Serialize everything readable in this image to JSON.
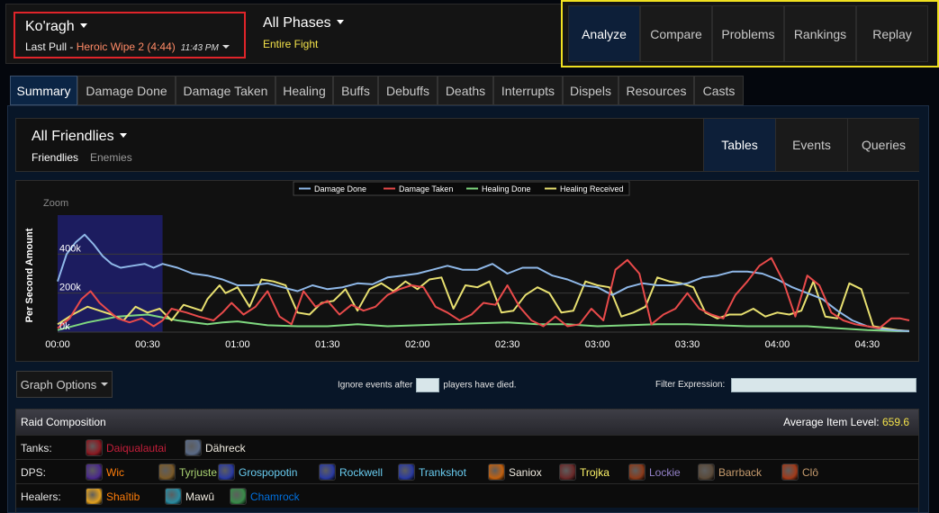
{
  "fight": {
    "boss": "Ko'ragh",
    "pull_prefix": "Last Pull - ",
    "pull_name": "Heroic Wipe 2 (4:44)",
    "pull_time": "11:43 PM"
  },
  "phase": {
    "name": "All Phases",
    "sub": "Entire Fight"
  },
  "nav": [
    "Analyze",
    "Compare",
    "Problems",
    "Rankings",
    "Replay"
  ],
  "tabs": [
    "Summary",
    "Damage Done",
    "Damage Taken",
    "Healing",
    "Buffs",
    "Debuffs",
    "Deaths",
    "Interrupts",
    "Dispels",
    "Resources",
    "Casts"
  ],
  "friendly": {
    "title": "All Friendlies",
    "friendlies": "Friendlies",
    "enemies": "Enemies"
  },
  "views": [
    "Tables",
    "Events",
    "Queries"
  ],
  "chart_data": {
    "type": "line",
    "ylabel": "Per Second Amount",
    "zoom_label": "Zoom",
    "ytick_labels": [
      "0k",
      "200k",
      "400k"
    ],
    "yticks": [
      0,
      200,
      400
    ],
    "ylim": [
      0,
      600
    ],
    "xlim": [
      0,
      284
    ],
    "xticks": [
      0,
      30,
      60,
      90,
      120,
      150,
      180,
      210,
      240,
      270
    ],
    "xtick_labels": [
      "00:00",
      "00:30",
      "01:00",
      "01:30",
      "02:00",
      "02:30",
      "03:00",
      "03:30",
      "04:00",
      "04:30"
    ],
    "zoom_range": [
      0,
      35
    ],
    "legend_position": "top-center",
    "series": [
      {
        "name": "Damage Done",
        "color": "#8fb8e8",
        "x": [
          0,
          3,
          6,
          9,
          12,
          15,
          18,
          21,
          25,
          29,
          32,
          35,
          40,
          45,
          50,
          55,
          60,
          65,
          70,
          75,
          80,
          85,
          90,
          95,
          100,
          105,
          110,
          115,
          120,
          125,
          130,
          135,
          140,
          145,
          150,
          155,
          160,
          165,
          170,
          175,
          180,
          185,
          190,
          195,
          200,
          205,
          210,
          215,
          220,
          225,
          230,
          235,
          240,
          245,
          250,
          255,
          260,
          265,
          270,
          275,
          280,
          284
        ],
        "y": [
          260,
          400,
          460,
          500,
          450,
          390,
          350,
          330,
          340,
          350,
          330,
          350,
          330,
          300,
          290,
          270,
          240,
          240,
          250,
          230,
          210,
          240,
          220,
          230,
          250,
          245,
          280,
          290,
          300,
          320,
          340,
          320,
          320,
          350,
          300,
          330,
          330,
          290,
          270,
          240,
          230,
          190,
          230,
          250,
          240,
          240,
          250,
          280,
          290,
          310,
          310,
          300,
          270,
          230,
          200,
          170,
          110,
          60,
          30,
          15,
          8,
          5
        ]
      },
      {
        "name": "Damage Taken",
        "color": "#e84a4a",
        "x": [
          0,
          4,
          8,
          11,
          14,
          17,
          20,
          24,
          28,
          32,
          35,
          38,
          43,
          47,
          52,
          55,
          58,
          62,
          66,
          70,
          74,
          78,
          82,
          86,
          90,
          94,
          98,
          102,
          106,
          110,
          114,
          118,
          122,
          126,
          130,
          134,
          138,
          142,
          146,
          150,
          154,
          158,
          162,
          166,
          170,
          174,
          178,
          182,
          186,
          190,
          194,
          198,
          202,
          206,
          210,
          214,
          218,
          222,
          226,
          230,
          234,
          238,
          242,
          246,
          250,
          254,
          258,
          262,
          266,
          270,
          274,
          278,
          281,
          284
        ],
        "y": [
          20,
          70,
          170,
          210,
          150,
          110,
          70,
          50,
          70,
          30,
          60,
          120,
          100,
          80,
          60,
          100,
          150,
          90,
          130,
          210,
          80,
          40,
          210,
          130,
          160,
          90,
          140,
          110,
          130,
          190,
          220,
          240,
          230,
          130,
          100,
          60,
          90,
          150,
          140,
          240,
          130,
          60,
          30,
          80,
          30,
          40,
          120,
          60,
          320,
          370,
          300,
          40,
          90,
          120,
          200,
          120,
          90,
          70,
          190,
          260,
          340,
          380,
          260,
          80,
          290,
          240,
          100,
          60,
          40,
          30,
          20,
          70,
          70,
          60
        ]
      },
      {
        "name": "Healing Done",
        "color": "#7fd87f",
        "x": [
          0,
          10,
          20,
          30,
          40,
          50,
          55,
          60,
          70,
          80,
          90,
          100,
          110,
          120,
          130,
          140,
          150,
          160,
          170,
          180,
          190,
          200,
          210,
          220,
          230,
          240,
          250,
          260,
          270,
          280,
          284
        ],
        "y": [
          10,
          50,
          80,
          90,
          60,
          40,
          50,
          55,
          35,
          30,
          30,
          40,
          30,
          35,
          40,
          45,
          50,
          40,
          40,
          30,
          35,
          40,
          40,
          35,
          30,
          30,
          30,
          20,
          10,
          5,
          5
        ]
      },
      {
        "name": "Healing Received",
        "color": "#e8e070",
        "x": [
          0,
          5,
          10,
          14,
          18,
          22,
          26,
          30,
          34,
          38,
          42,
          48,
          50,
          54,
          56,
          60,
          64,
          68,
          72,
          76,
          80,
          84,
          88,
          92,
          96,
          100,
          104,
          108,
          112,
          116,
          120,
          124,
          128,
          132,
          136,
          140,
          144,
          148,
          152,
          156,
          160,
          164,
          168,
          172,
          176,
          180,
          184,
          188,
          192,
          196,
          200,
          204,
          208,
          212,
          216,
          220,
          224,
          228,
          232,
          236,
          240,
          244,
          248,
          252,
          256,
          260,
          264,
          268,
          272,
          276,
          280,
          284
        ],
        "y": [
          40,
          90,
          130,
          110,
          90,
          60,
          130,
          100,
          120,
          60,
          140,
          110,
          170,
          240,
          200,
          230,
          130,
          270,
          260,
          240,
          100,
          90,
          150,
          160,
          220,
          110,
          220,
          250,
          210,
          260,
          220,
          270,
          280,
          120,
          240,
          230,
          260,
          100,
          110,
          190,
          230,
          200,
          100,
          110,
          260,
          240,
          230,
          80,
          100,
          130,
          280,
          260,
          250,
          230,
          100,
          70,
          90,
          90,
          120,
          80,
          100,
          90,
          110,
          260,
          80,
          70,
          250,
          220,
          30,
          20,
          10,
          5
        ]
      }
    ]
  },
  "controls": {
    "graph_options": "Graph Options",
    "ignore_before": "Ignore events after",
    "ignore_after": "players have died.",
    "filter_label": "Filter Expression:"
  },
  "raid": {
    "title": "Raid Composition",
    "ilvl_label": "Average Item Level: ",
    "ilvl_value": "659.6",
    "rows": [
      {
        "label": "Tanks:",
        "players": [
          {
            "name": "Daiqualautai",
            "color": "#c41e3a",
            "icon": "death-knight-icon",
            "icon_color": "#8a1a22"
          },
          {
            "name": "Dähreck",
            "color": "#f0ebe0",
            "icon": "shield-icon",
            "icon_color": "#5a6a86"
          }
        ]
      },
      {
        "label": "DPS:",
        "players": [
          {
            "name": "Wic",
            "color": "#ff7d0a",
            "icon": "arcane-icon",
            "icon_color": "#4a2a8a"
          },
          {
            "name": "Tyrjuste",
            "color": "#abd473",
            "icon": "claw-icon",
            "icon_color": "#7a5a2a"
          },
          {
            "name": "Grospopotin",
            "color": "#69ccf0",
            "icon": "frost-bolt-icon",
            "icon_color": "#2a3aa0"
          },
          {
            "name": "Rockwell",
            "color": "#69ccf0",
            "icon": "frost-bolt-icon",
            "icon_color": "#2a3aa0"
          },
          {
            "name": "Trankshot",
            "color": "#69ccf0",
            "icon": "frost-bolt-icon",
            "icon_color": "#2a3aa0"
          },
          {
            "name": "Saniox",
            "color": "#f0ebe0",
            "icon": "fire-face-icon",
            "icon_color": "#c06010"
          },
          {
            "name": "Trojka",
            "color": "#fff569",
            "icon": "dagger-icon",
            "icon_color": "#6a2a2a"
          },
          {
            "name": "Lockie",
            "color": "#9482c9",
            "icon": "shadowbolt-icon",
            "icon_color": "#8a3a1a"
          },
          {
            "name": "Barrback",
            "color": "#c79c6e",
            "icon": "axe-icon",
            "icon_color": "#5a4a3a"
          },
          {
            "name": "Clô",
            "color": "#c79c6e",
            "icon": "fury-icon",
            "icon_color": "#a03a1a"
          }
        ]
      },
      {
        "label": "Healers:",
        "players": [
          {
            "name": "Shaîtib",
            "color": "#ff7d0a",
            "icon": "starburst-icon",
            "icon_color": "#e0a020"
          },
          {
            "name": "Mawû",
            "color": "#f0ebe0",
            "icon": "monk-icon",
            "icon_color": "#2a8aa0"
          },
          {
            "name": "Chamrock",
            "color": "#0070de",
            "icon": "chain-heal-icon",
            "icon_color": "#3a8a4a"
          }
        ]
      }
    ]
  }
}
